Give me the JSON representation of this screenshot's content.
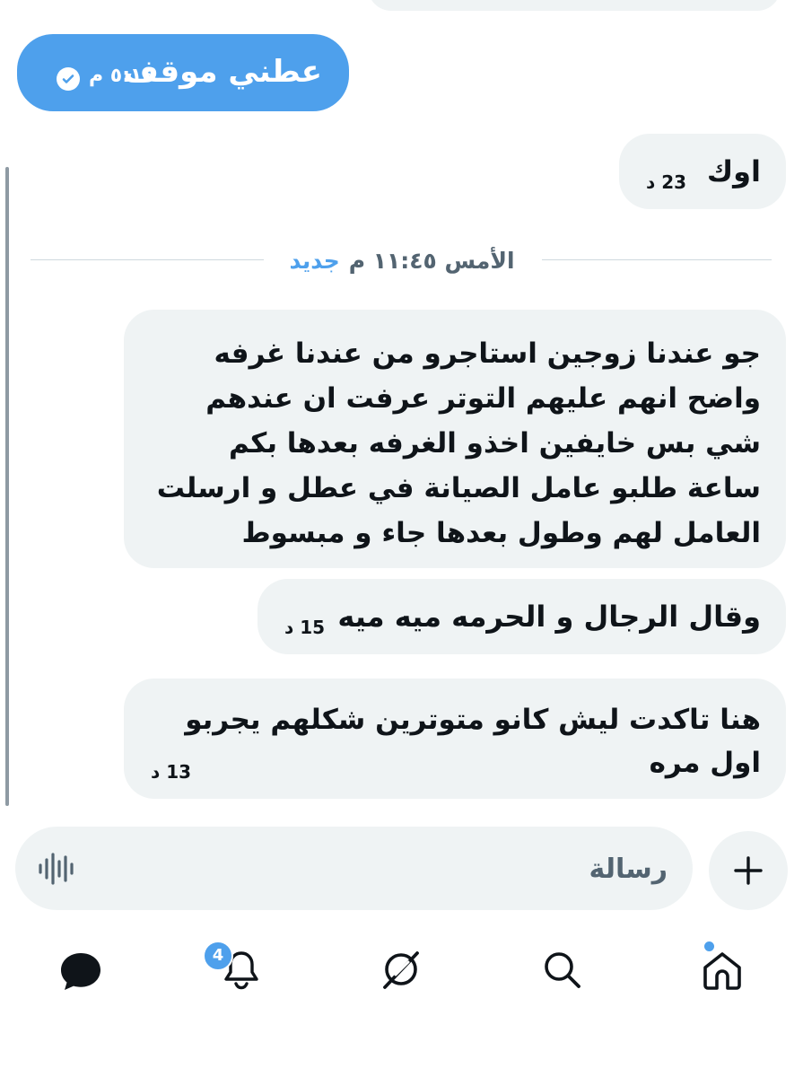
{
  "conversation": {
    "sent": {
      "text": "عطني موقف",
      "time": "٥:١٤ م"
    },
    "messages": [
      {
        "text": "اوك",
        "time": "23 د"
      },
      {
        "text": "جو عندنا زوجين استاجرو من عندنا غرفه\nواضح انهم عليهم التوتر عرفت ان عندهم\nشي بس خايفين اخذو الغرفه بعدها بكم\nساعة طلبو عامل الصيانة في عطل و ارسلت\nالعامل لهم وطول بعدها جاء و مبسوط",
        "time": ""
      },
      {
        "text": "وقال الرجال و الحرمه ميه ميه",
        "time": "15 د"
      },
      {
        "text": "هنا تاكدت ليش كانو متوترين شكلهم يجربو\nاول مره",
        "time": "13 د"
      }
    ],
    "divider": {
      "label": "الأمس ١١:٤٥ م",
      "new_label": "جديد"
    }
  },
  "composer": {
    "placeholder": "رسالة",
    "add_icon": "plus-icon",
    "voice_icon": "waveform-icon"
  },
  "bottom_nav": {
    "items": [
      "messages-icon",
      "notifications-icon",
      "grok-icon",
      "search-icon",
      "home-icon"
    ],
    "notification_count": "4"
  },
  "colors": {
    "accent": "#4ea0ec",
    "bubble_incoming": "#eff3f4",
    "text": "#0f1419",
    "muted": "#536471"
  }
}
